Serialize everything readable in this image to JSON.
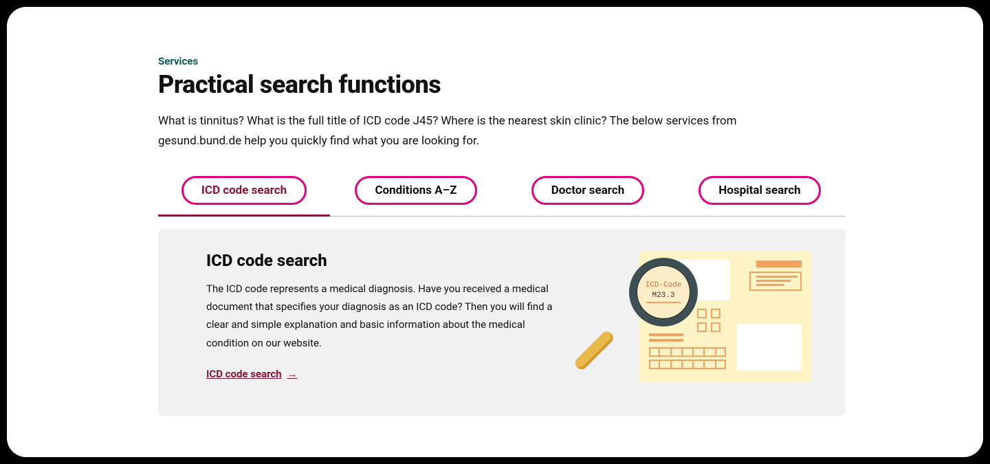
{
  "eyebrow": "Services",
  "title": "Practical search functions",
  "intro": "What is tinnitus? What is the full title of ICD code J45? Where is the nearest skin clinic? The below services from gesund.bund.de help you quickly find what you are looking for.",
  "tabs": [
    {
      "label": "ICD code search",
      "active": true
    },
    {
      "label": "Conditions A–Z",
      "active": false
    },
    {
      "label": "Doctor search",
      "active": false
    },
    {
      "label": "Hospital search",
      "active": false
    }
  ],
  "panel": {
    "title": "ICD code search",
    "body": "The ICD code represents a medical diagnosis. Have you received a medical document that specifies your diagnosis as an ICD code? Then you will find a clear and simple explanation and basic information about the medical condition on our website.",
    "link_label": "ICD code search",
    "illustration": {
      "label_line1": "ICD-Code",
      "label_line2": "M23.3"
    }
  },
  "colors": {
    "accent_pink": "#e6007e",
    "accent_maroon": "#8b1538",
    "teal": "#0a5a5a"
  }
}
